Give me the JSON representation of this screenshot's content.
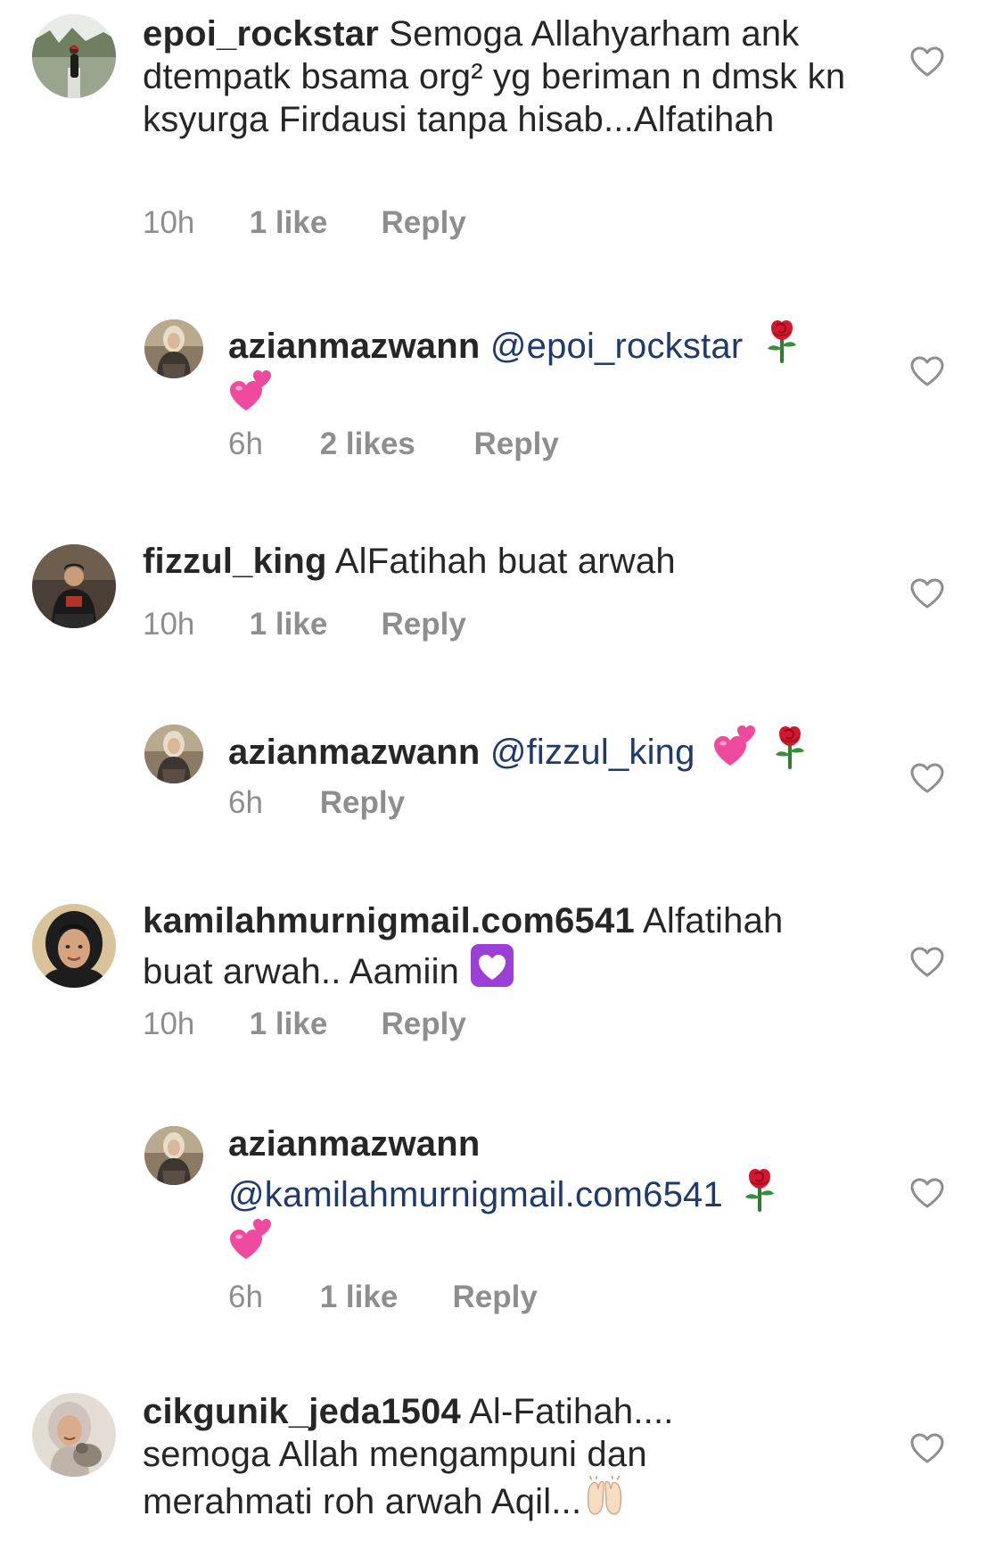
{
  "comments": [
    {
      "username": "epoi_rockstar",
      "text": "Semoga Allahyarham ank dtempatk bsama org² yg beriman n dmsk kn ksyurga Firdausi tanpa hisab...Alfatihah",
      "time": "10h",
      "likes": "1 like",
      "reply": "Reply"
    },
    {
      "username": "azianmazwann",
      "mention": "@epoi_rockstar",
      "emoji": [
        "rose",
        "two-hearts"
      ],
      "time": "6h",
      "likes": "2 likes",
      "reply": "Reply"
    },
    {
      "username": "fizzul_king",
      "text": "AlFatihah buat arwah",
      "time": "10h",
      "likes": "1 like",
      "reply": "Reply"
    },
    {
      "username": "azianmazwann",
      "mention": "@fizzul_king",
      "emoji": [
        "two-hearts",
        "rose"
      ],
      "time": "6h",
      "reply": "Reply"
    },
    {
      "username": "kamilahmurnigmail.com6541",
      "text_line1": "Alfatihah",
      "text_line2": "buat arwah.. Aamiin",
      "emoji": [
        "heart-decoration"
      ],
      "time": "10h",
      "likes": "1 like",
      "reply": "Reply"
    },
    {
      "username": "azianmazwann",
      "mention": "@kamilahmurnigmail.com6541",
      "emoji": [
        "rose",
        "two-hearts"
      ],
      "time": "6h",
      "likes": "1 like",
      "reply": "Reply"
    },
    {
      "username": "cikgunik_jeda1504",
      "text_line1": "Al-Fatihah....",
      "text_line2": "semoga Allah mengampuni dan",
      "text_line3": "merahmati roh arwah Aqil...",
      "emoji": [
        "raising-hands"
      ]
    }
  ],
  "colors": {
    "text": "#262626",
    "meta": "#8e8e8e",
    "mention": "#1f3a6d",
    "heart_outline": "#8e8e8e"
  }
}
